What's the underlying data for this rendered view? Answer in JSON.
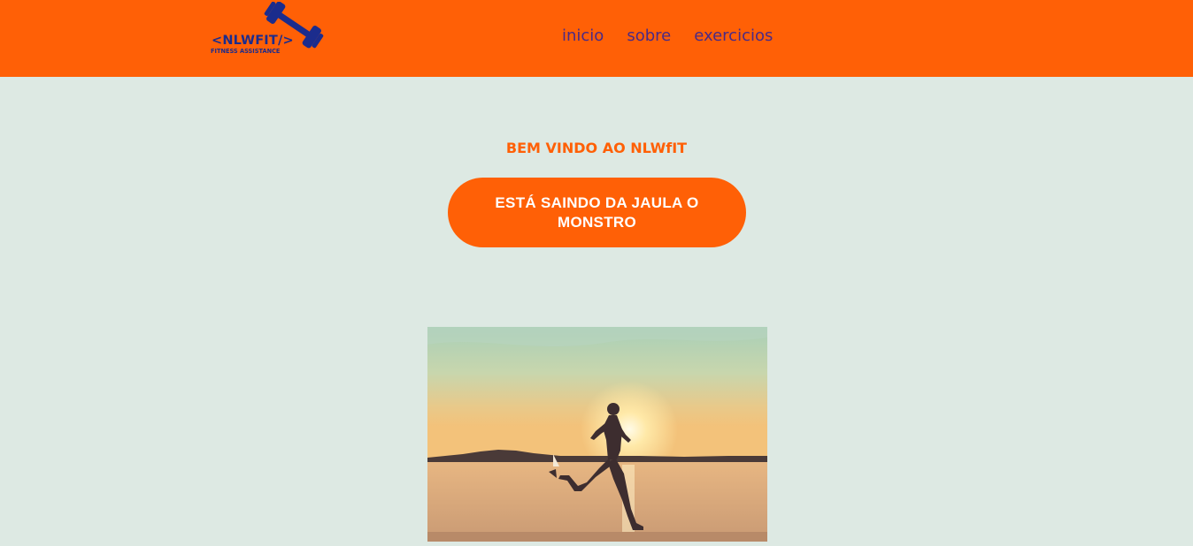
{
  "header": {
    "logo": {
      "title": "<NLWFIT/>",
      "subtitle": "FITNESS ASSISTANCE",
      "icon": "dumbbell-icon"
    },
    "nav": [
      {
        "label": "inicio"
      },
      {
        "label": "sobre"
      },
      {
        "label": "exercicios"
      }
    ]
  },
  "main": {
    "welcome": "BEM VINDO AO NLWfIT",
    "cta_label": "ESTÁ SAINDO DA JAULA O MONSTRO",
    "hero_image": "runner-on-beach-at-sunset"
  },
  "colors": {
    "brand_orange": "#ff6006",
    "page_background": "#dde9e3",
    "logo_blue": "#1b2c8d",
    "nav_text": "#4a2a86"
  }
}
